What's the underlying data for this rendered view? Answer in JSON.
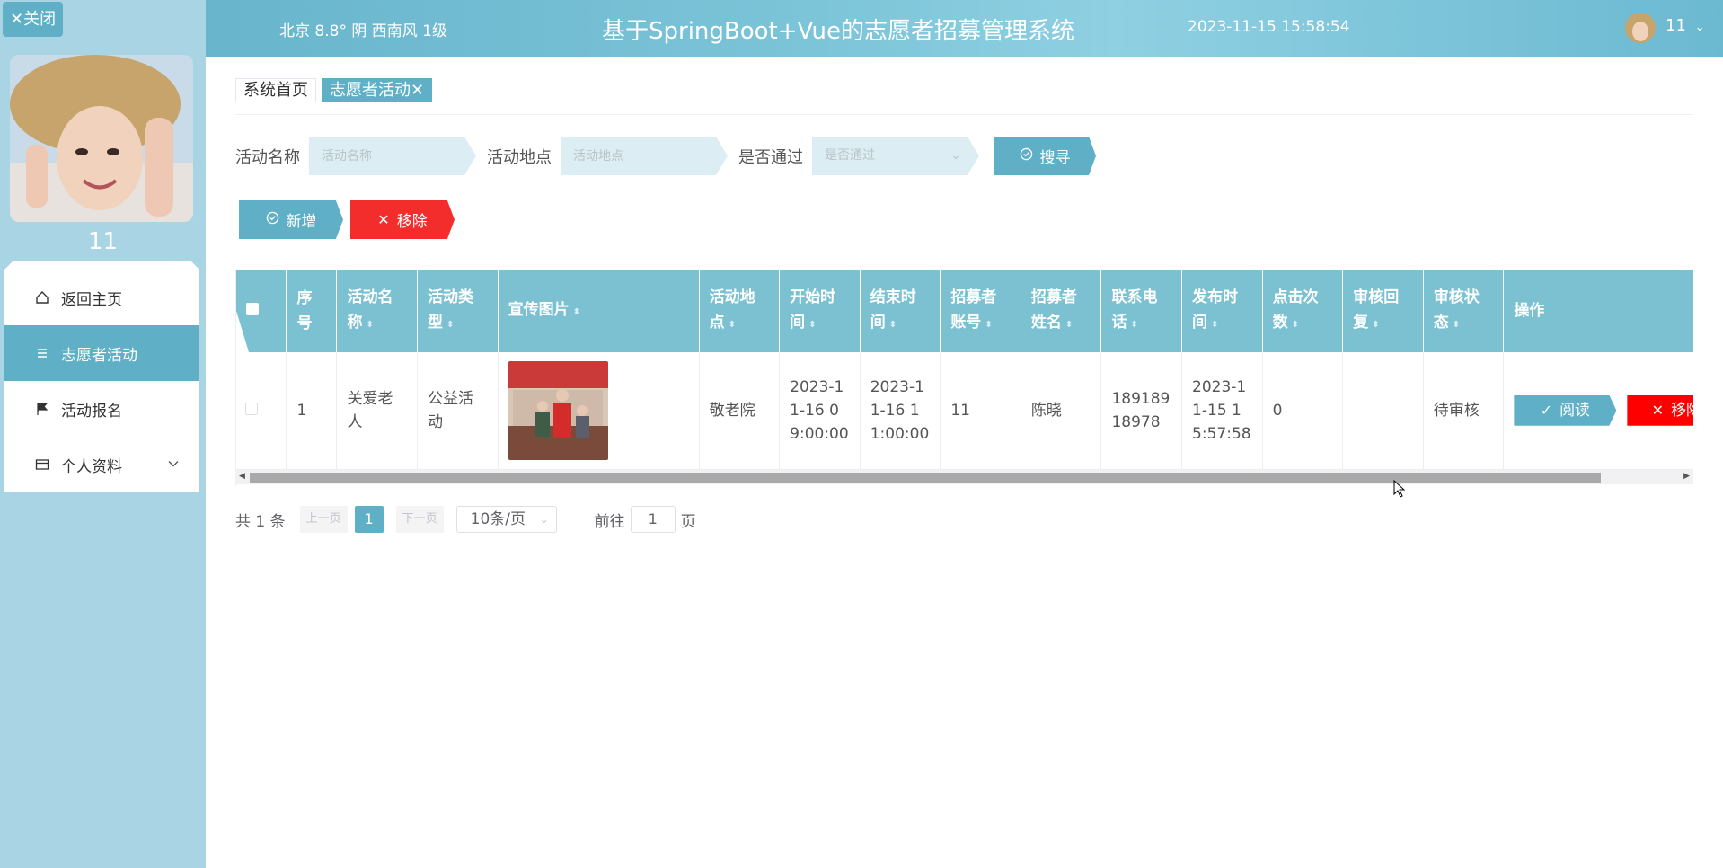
{
  "sidebar": {
    "close_label": "关闭",
    "user_name": "11",
    "items": [
      {
        "label": "返回主页",
        "icon": "home-icon"
      },
      {
        "label": "志愿者活动",
        "icon": "list-icon",
        "active": true
      },
      {
        "label": "活动报名",
        "icon": "flag-icon"
      },
      {
        "label": "个人资料",
        "icon": "card-icon",
        "expandable": true
      }
    ]
  },
  "header": {
    "weather": "北京  8.8°  阴  西南风  1级",
    "title": "基于SpringBoot+Vue的志愿者招募管理系统",
    "datetime": "2023-11-15 15:58:54",
    "user": "11"
  },
  "tabs": [
    {
      "label": "系统首页"
    },
    {
      "label": "志愿者活动✕",
      "active": true
    }
  ],
  "search": {
    "name_label": "活动名称",
    "name_placeholder": "活动名称",
    "place_label": "活动地点",
    "place_placeholder": "活动地点",
    "pass_label": "是否通过",
    "pass_placeholder": "是否通过",
    "search_button": "搜寻"
  },
  "actions": {
    "add_label": "新增",
    "delete_label": "移除"
  },
  "table": {
    "headers": [
      "序号",
      "活动名称",
      "活动类型",
      "宣传图片",
      "活动地点",
      "开始时间",
      "结束时间",
      "招募者账号",
      "招募者姓名",
      "联系电话",
      "发布时间",
      "点击次数",
      "审核回复",
      "审核状态",
      "操作"
    ],
    "rows": [
      {
        "index": "1",
        "name": "关爱老人",
        "type": "公益活动",
        "place": "敬老院",
        "start": "2023-11-16 09:00:00",
        "end": "2023-11-16 11:00:00",
        "account": "11",
        "recruiter": "陈晓",
        "phone": "18918918978",
        "published": "2023-11-15 15:57:58",
        "clicks": "0",
        "reply": "",
        "status": "待审核",
        "read_label": "阅读",
        "delete_label": "移除"
      }
    ]
  },
  "pagination": {
    "total": "共 1 条",
    "prev": "上一页",
    "current": "1",
    "next": "下一页",
    "page_size": "10条/页",
    "goto_label": "前往",
    "goto_value": "1",
    "page_suffix": "页"
  },
  "colors": {
    "accent": "#5fb0c6",
    "danger": "#f32c2c",
    "sidebar_bg": "#a8d4e3",
    "header_bg": "#7bc1d2"
  }
}
